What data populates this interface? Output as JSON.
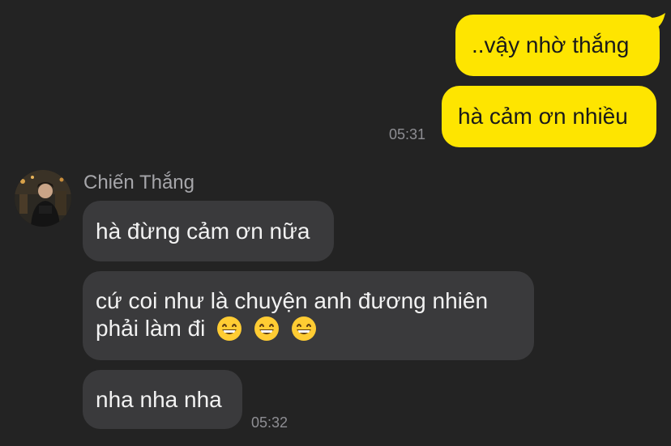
{
  "colors": {
    "background": "#232323",
    "outgoing_bubble": "#FEE500",
    "incoming_bubble": "#3A3A3C",
    "timestamp": "#8E8E93"
  },
  "outgoing": [
    {
      "text": "..vậy nhờ thắng"
    },
    {
      "text": "hà cảm ơn nhiều"
    }
  ],
  "outgoing_time": "05:31",
  "sender": {
    "name": "Chiến Thắng",
    "avatar_icon": "profile-photo-avatar"
  },
  "incoming": [
    {
      "text": "hà đừng cảm ơn nữa"
    },
    {
      "line1": "cứ coi như là chuyện anh đương nhiên",
      "line2": "phải làm đi",
      "emoji": "grinning-face-icon",
      "emoji_count": 3
    },
    {
      "text": "nha nha nha"
    }
  ],
  "incoming_time": "05:32"
}
